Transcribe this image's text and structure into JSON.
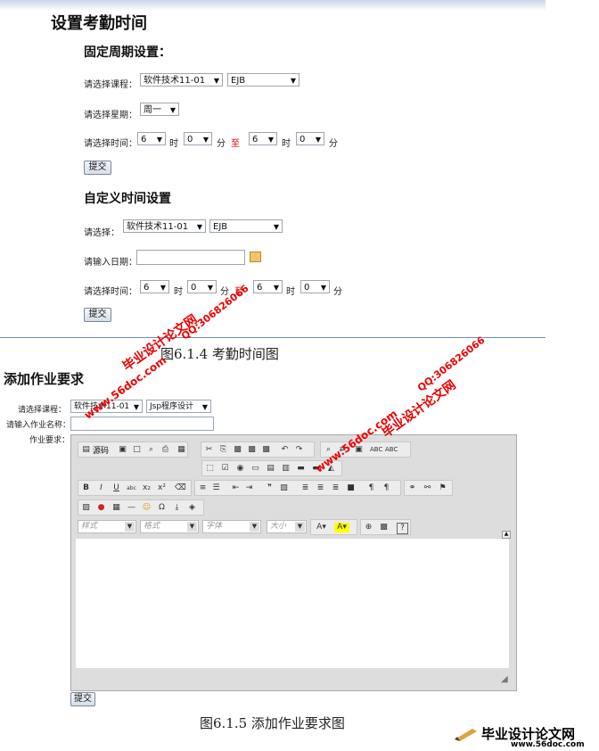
{
  "section1": {
    "title": "设置考勤时间",
    "fixed": {
      "title": "固定周期设置：",
      "course_label": "请选择课程：",
      "course_value": "软件技术11-01",
      "subject_value": "EJB",
      "week_label": "请选择星期：",
      "week_value": "周一",
      "time_label": "请选择时间：",
      "hour1": "6",
      "min1": "0",
      "hour2": "6",
      "min2": "0",
      "hour_unit": "时",
      "min_unit": "分",
      "to": "至",
      "submit": "提交"
    },
    "custom": {
      "title": "自定义时间设置",
      "select_label": "请选择：",
      "course_value": "软件技术11-01",
      "subject_value": "EJB",
      "date_label": "请输入日期：",
      "time_label": "请选择时间：",
      "hour1": "6",
      "min1": "0",
      "hour2": "6",
      "min2": "0",
      "hour_unit": "时",
      "min_unit": "分",
      "to": "至",
      "submit": "提交"
    },
    "caption": "图6.1.4 考勤时间图"
  },
  "section2": {
    "title": "添加作业要求",
    "course_label": "请选择课程：",
    "course_value": "软件技术11-01",
    "subject_value": "Jsp程序设计",
    "name_label": "请输入作业名称：",
    "req_label": "作业要求：",
    "submit": "提交",
    "caption": "图6.1.5 添加作业要求图"
  },
  "editor": {
    "source_label": "源码",
    "style_placeholder": "样式",
    "format_placeholder": "格式",
    "font_placeholder": "字体",
    "size_placeholder": "大小"
  },
  "watermark": {
    "site_cn": "毕业设计论文网",
    "site_url": "www.56doc.com",
    "qq": "QQ:306826066"
  },
  "logo": {
    "title": "毕业设计论文网",
    "url": "www.56doc.com"
  }
}
